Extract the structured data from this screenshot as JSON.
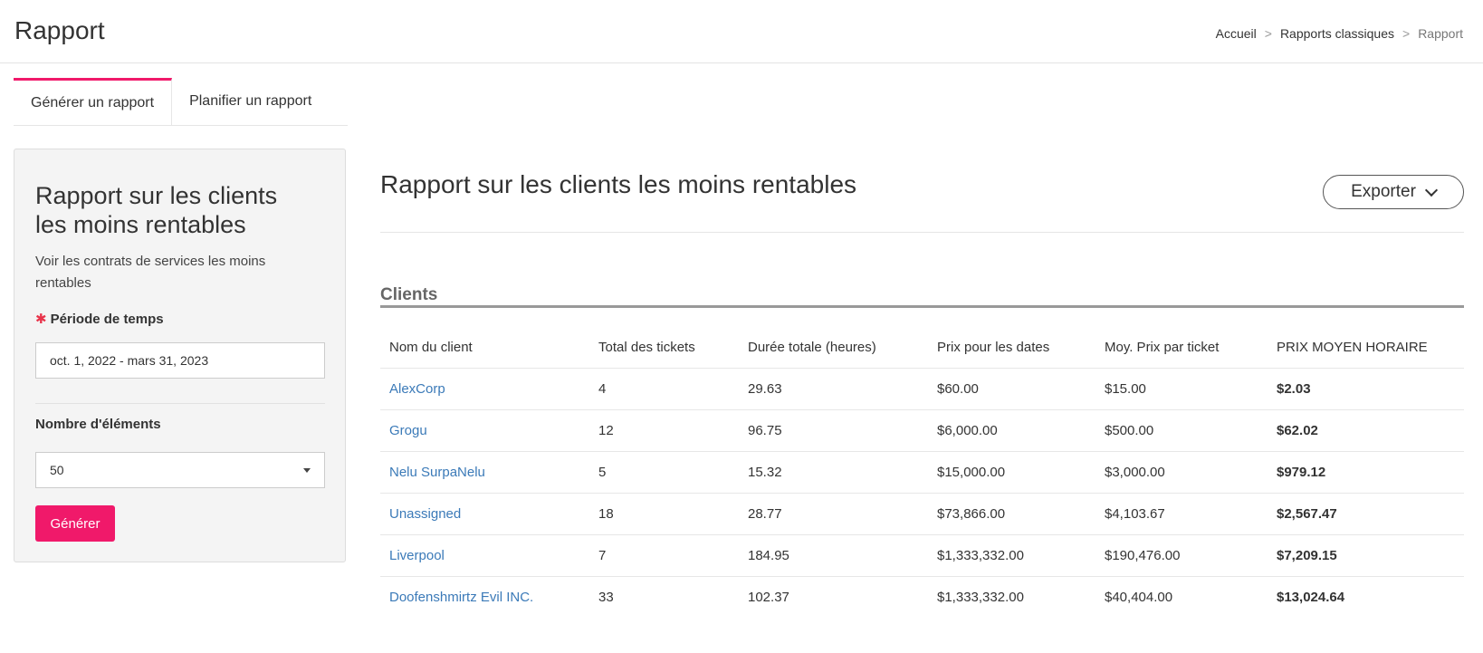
{
  "header": {
    "title": "Rapport",
    "breadcrumb": [
      {
        "label": "Accueil"
      },
      {
        "label": "Rapports classiques"
      },
      {
        "label": "Rapport"
      }
    ],
    "separator": ">"
  },
  "tabs": [
    {
      "label": "Générer un rapport",
      "active": true
    },
    {
      "label": "Planifier un rapport",
      "active": false
    }
  ],
  "sidebar": {
    "title": "Rapport sur les clients les moins rentables",
    "description": "Voir les contrats de services les moins rentables",
    "period": {
      "label": "Période de temps",
      "required_mark": "✱",
      "value": "oct. 1, 2022 - mars 31, 2023"
    },
    "count": {
      "label": "Nombre d'éléments",
      "selected": "50"
    },
    "generate_label": "Générer"
  },
  "main": {
    "report_title": "Rapport sur les clients les moins rentables",
    "export_label": "Exporter",
    "section_title": "Clients",
    "columns": [
      "Nom du client",
      "Total des tickets",
      "Durée totale (heures)",
      "Prix pour les dates",
      "Moy. Prix par ticket",
      "PRIX MOYEN HORAIRE"
    ],
    "rows": [
      [
        "AlexCorp",
        "4",
        "29.63",
        "$60.00",
        "$15.00",
        "$2.03"
      ],
      [
        "Grogu",
        "12",
        "96.75",
        "$6,000.00",
        "$500.00",
        "$62.02"
      ],
      [
        "Nelu SurpaNelu",
        "5",
        "15.32",
        "$15,000.00",
        "$3,000.00",
        "$979.12"
      ],
      [
        "Unassigned",
        "18",
        "28.77",
        "$73,866.00",
        "$4,103.67",
        "$2,567.47"
      ],
      [
        "Liverpool",
        "7",
        "184.95",
        "$1,333,332.00",
        "$190,476.00",
        "$7,209.15"
      ],
      [
        "Doofenshmirtz Evil INC.",
        "33",
        "102.37",
        "$1,333,332.00",
        "$40,404.00",
        "$13,024.64"
      ]
    ]
  },
  "colors": {
    "accent": "#f0196a",
    "link": "#3b7ab8",
    "required": "#e8334a"
  }
}
